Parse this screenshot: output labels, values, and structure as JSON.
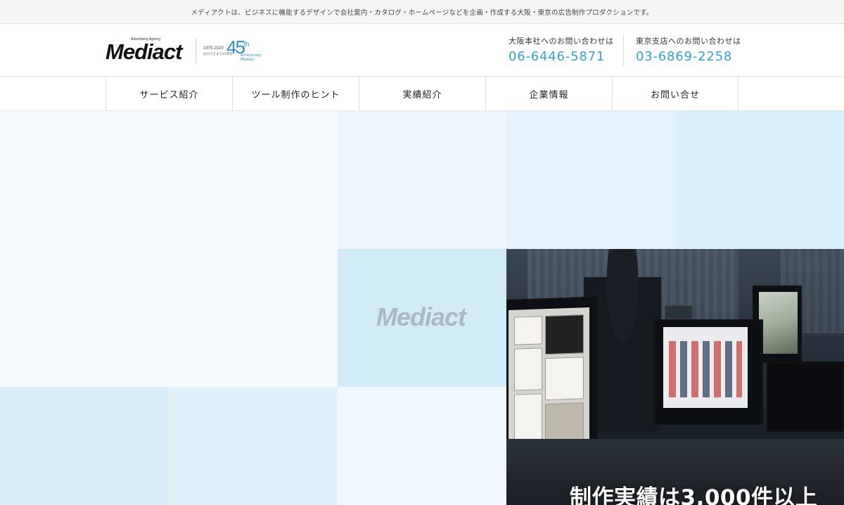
{
  "topbar": {
    "text": "メディアクトは、ビジネスに機能するデザインで会社案内・カタログ・ホームページなどを企画・作成する大阪・東京の広告制作プロダクションです。"
  },
  "header": {
    "logo": {
      "wordmark": "Mediact",
      "tagline": "Advertising Agency",
      "anniversary_years": "1975-2020",
      "anniversary_sub": "おかげさまで45周年",
      "anniversary_number": "45",
      "anniversary_suffix": "th",
      "anniversary_word": "Anniversary Mediact"
    },
    "contacts": [
      {
        "label": "大阪本社へのお問い合わせは",
        "phone": "06-6446-5871"
      },
      {
        "label": "東京支店へのお問い合わせは",
        "phone": "03-6869-2258"
      }
    ]
  },
  "nav": {
    "items": [
      {
        "label": "サービス紹介"
      },
      {
        "label": "ツール制作のヒント"
      },
      {
        "label": "実績紹介"
      },
      {
        "label": "企業情報"
      },
      {
        "label": "お問い合せ"
      }
    ]
  },
  "hero": {
    "tile_logo": "Mediact",
    "photo_caption": "制作実績は3,000件以上",
    "colors": {
      "tile_light": "#f5fafd",
      "tile_mid": "#e3f2fb",
      "tile_accent": "#d2ebf8",
      "phone_blue": "#2ea3d6"
    }
  }
}
